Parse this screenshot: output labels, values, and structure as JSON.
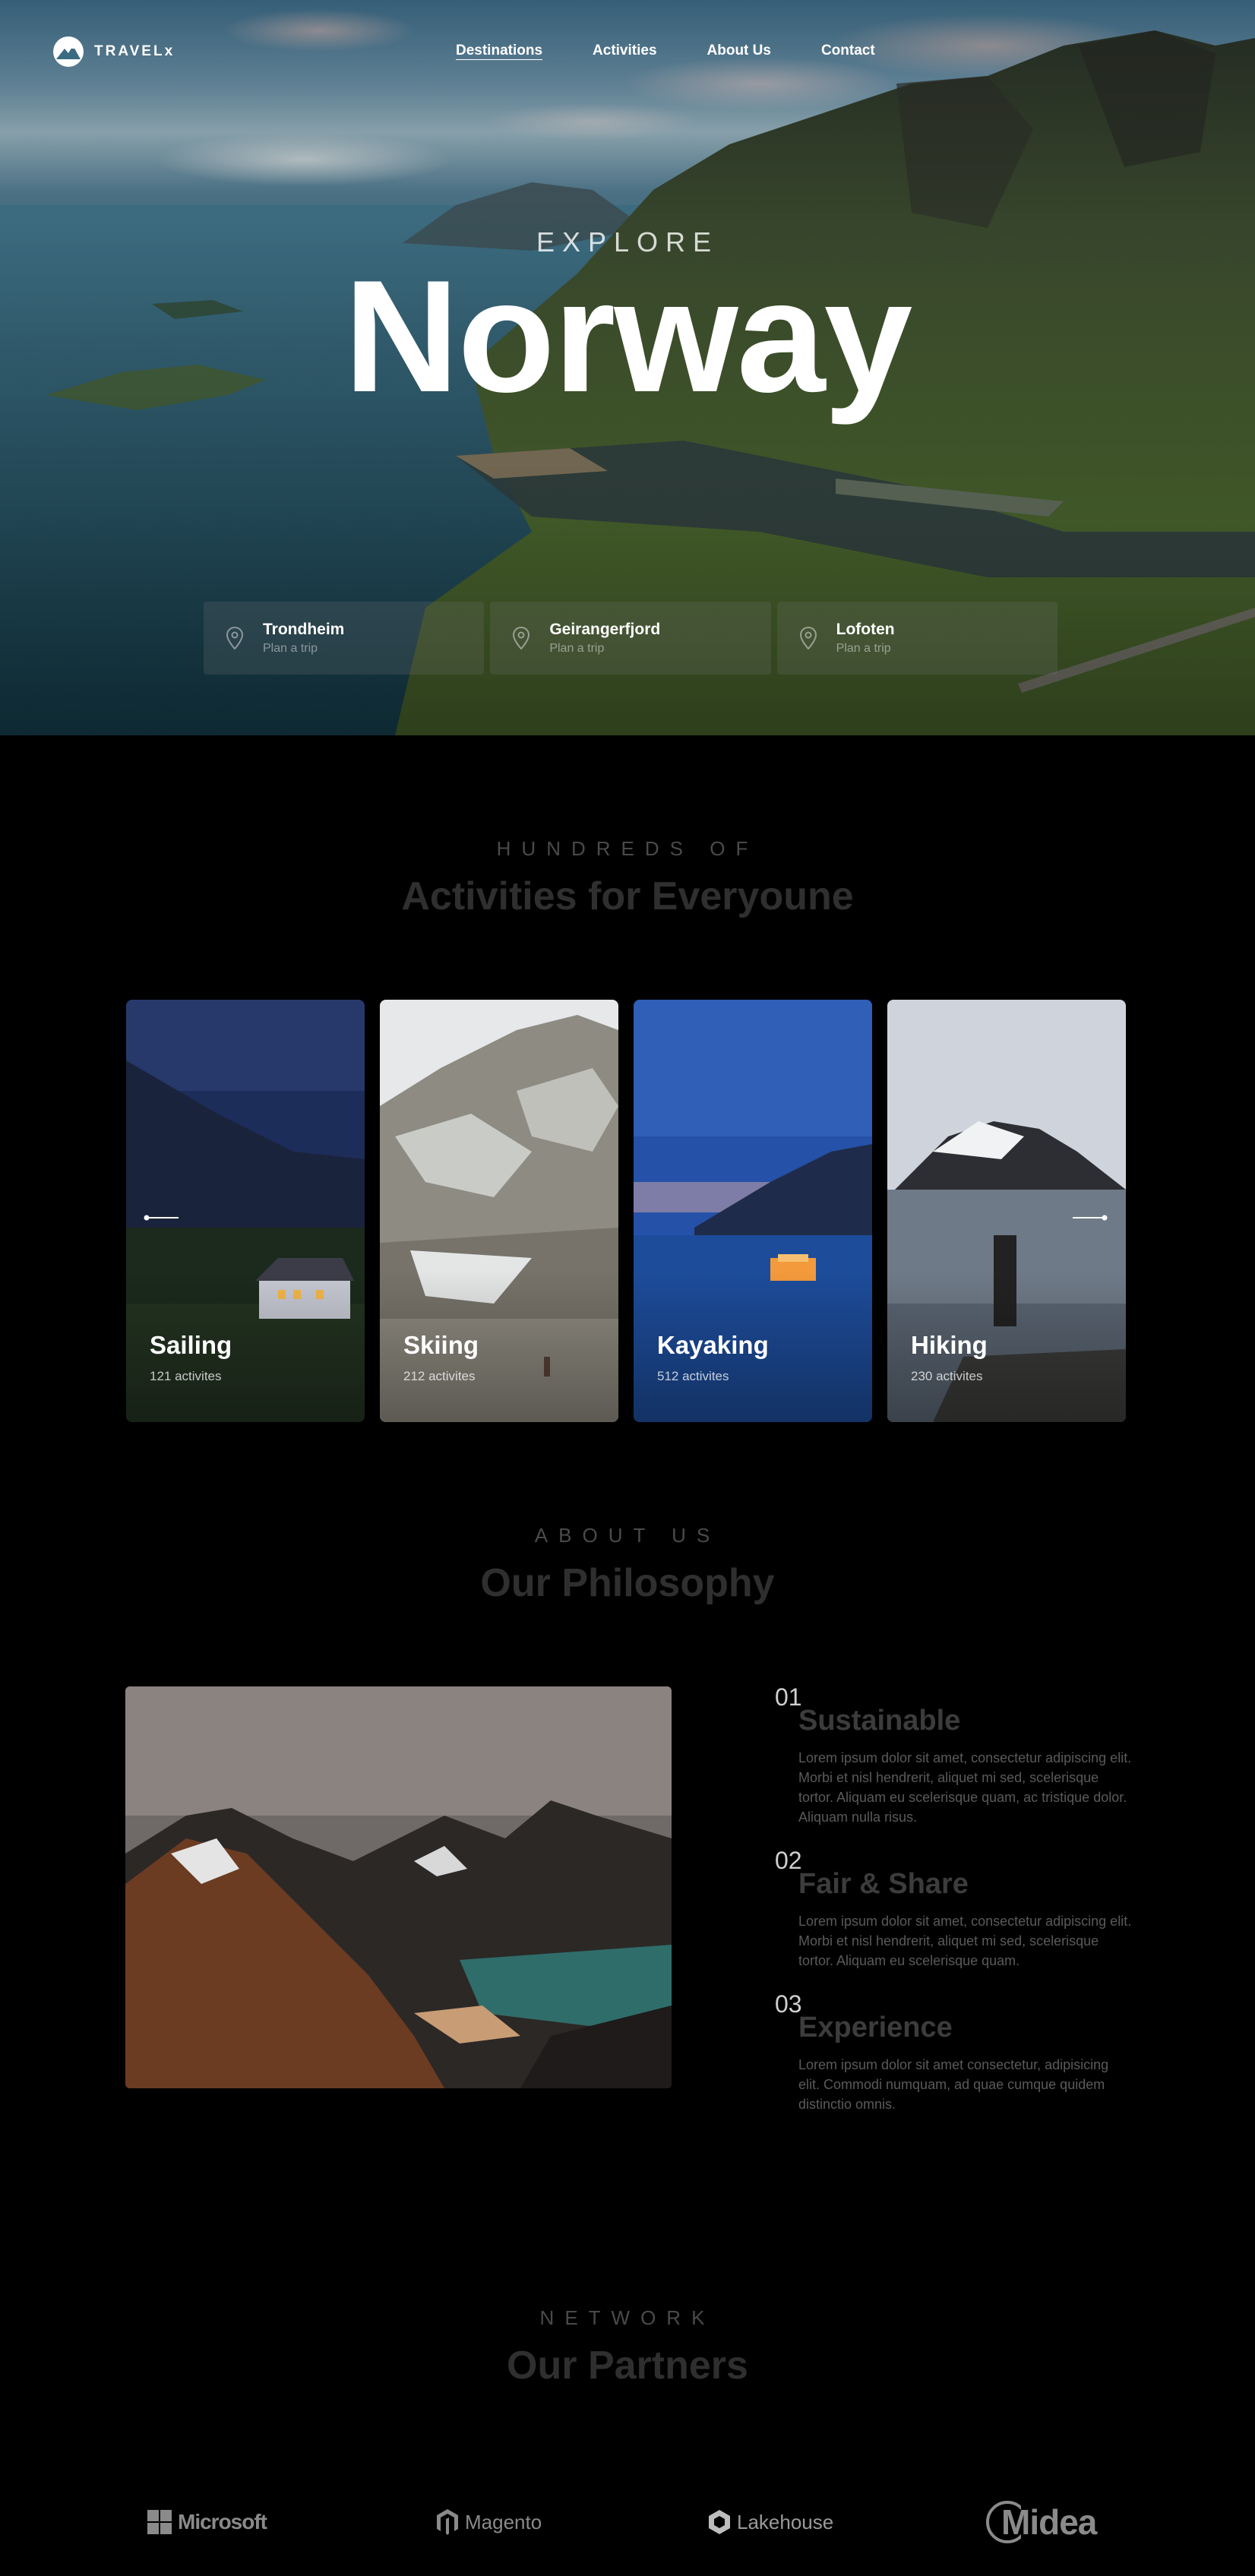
{
  "brand": {
    "name": "TRAVELx"
  },
  "nav": {
    "links": [
      "Destinations",
      "Activities",
      "About Us",
      "Contact"
    ]
  },
  "hero": {
    "kicker": "EXPLORE",
    "title": "Norway",
    "destinations": [
      {
        "name": "Trondheim",
        "sub": "Plan a trip",
        "icon": "map-pin-icon"
      },
      {
        "name": "Geirangerfjord",
        "sub": "Plan a trip",
        "icon": "map-pin-icon"
      },
      {
        "name": "Lofoten",
        "sub": "Plan a trip",
        "icon": "map-pin-icon"
      }
    ]
  },
  "activities": {
    "kicker": "HUNDREDS OF",
    "title": "Activities for Everyoune",
    "cards": [
      {
        "title": "Sailing",
        "count": "121 activites"
      },
      {
        "title": "Skiing",
        "count": "212 activites"
      },
      {
        "title": "Kayaking",
        "count": "512 activites"
      },
      {
        "title": "Hiking",
        "count": "230 activites"
      }
    ]
  },
  "about": {
    "kicker": "ABOUT US",
    "title": "Our Philosophy",
    "items": [
      {
        "num": "01",
        "heading": "Sustainable",
        "text": "Lorem ipsum dolor sit amet, consectetur adipiscing elit. Morbi et nisl hendrerit, aliquet mi sed, scelerisque tortor. Aliquam eu scelerisque quam, ac tristique dolor. Aliquam nulla risus."
      },
      {
        "num": "02",
        "heading": "Fair & Share",
        "text": "Lorem ipsum dolor sit amet, consectetur adipiscing elit. Morbi et nisl hendrerit, aliquet mi sed, scelerisque tortor. Aliquam eu scelerisque quam."
      },
      {
        "num": "03",
        "heading": "Experience",
        "text": "Lorem ipsum dolor sit amet consectetur, adipisicing elit. Commodi numquam, ad quae cumque quidem distinctio omnis."
      }
    ]
  },
  "partners": {
    "kicker": "NETWORK",
    "title": "Our Partners",
    "logos": [
      "Microsoft",
      "Magento",
      "Lakehouse",
      "Midea"
    ]
  },
  "colors": {
    "background": "#000000",
    "heading_dim": "#2f2f2f",
    "text_dim": "#5a5a5a"
  }
}
